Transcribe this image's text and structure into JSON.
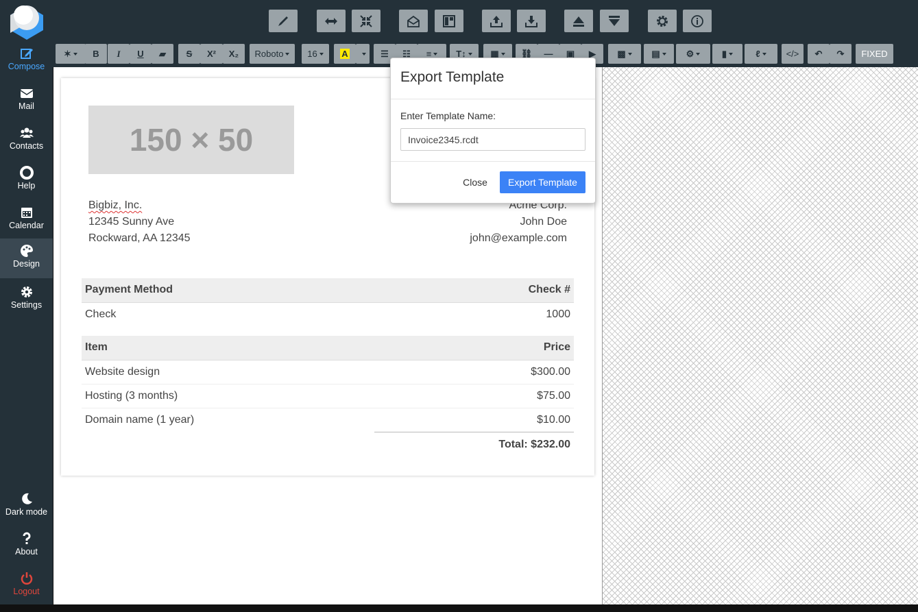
{
  "sidebar": {
    "items": [
      {
        "label": "Compose",
        "icon": "edit-icon"
      },
      {
        "label": "Mail",
        "icon": "envelope-icon"
      },
      {
        "label": "Contacts",
        "icon": "users-icon"
      },
      {
        "label": "Help",
        "icon": "lifebuoy-icon"
      },
      {
        "label": "Calendar",
        "icon": "calendar-icon"
      },
      {
        "label": "Design",
        "icon": "palette-icon"
      },
      {
        "label": "Settings",
        "icon": "gear-icon"
      }
    ],
    "bottom": [
      {
        "label": "Dark mode",
        "icon": "moon-icon"
      },
      {
        "label": "About",
        "icon": "question-icon"
      },
      {
        "label": "Logout",
        "icon": "power-icon"
      }
    ],
    "active_color": "#4aa8ff",
    "logout_color": "#e0463c"
  },
  "format_toolbar": {
    "bold": "B",
    "italic": "I",
    "underline": "U",
    "strike": "S",
    "superscript": "X²",
    "subscript": "X₂",
    "font": "Roboto",
    "size": "16",
    "highlight": "A",
    "code": "</>",
    "fixed": "FIXED"
  },
  "document": {
    "logo_placeholder": "150 × 50",
    "from": {
      "company": "Bigbiz, Inc.",
      "street": "12345 Sunny Ave",
      "city": "Rockward, AA 12345"
    },
    "to": {
      "company": "Acme Corp.",
      "name": "John Doe",
      "email": "john@example.com"
    },
    "payment": {
      "col1": "Payment Method",
      "col2": "Check #",
      "method": "Check",
      "number": "1000"
    },
    "items_header": {
      "col1": "Item",
      "col2": "Price"
    },
    "items": [
      {
        "name": "Website design",
        "price": "$300.00"
      },
      {
        "name": "Hosting (3 months)",
        "price": "$75.00"
      },
      {
        "name": "Domain name (1 year)",
        "price": "$10.00"
      }
    ],
    "total": "Total: $232.00"
  },
  "modal": {
    "title": "Export Template",
    "label": "Enter Template Name:",
    "value": "Invoice2345.rcdt",
    "close": "Close",
    "export": "Export Template",
    "primary_color": "#3b82f6"
  }
}
